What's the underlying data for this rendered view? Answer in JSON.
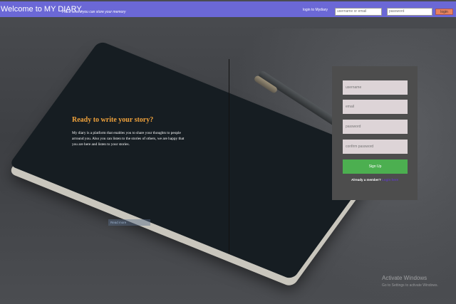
{
  "header": {
    "title": "Welcome to MY DIARY,",
    "tagline": "Place where you can store your memory",
    "login_label": "login to Mydiary",
    "username_placeholder": "username or email",
    "password_placeholder": "password",
    "login_button": "login",
    "bar_color": "#6b68d6"
  },
  "hero": {
    "heading": "Ready to write your story?",
    "description": "My diary is a platform that enables you to share your thoughts to people arround you. Also you can listen to the stories of others, we are happy that you are here and listen to your stories.",
    "heading_color": "#f0a23b"
  },
  "small_link": {
    "label": "Read more"
  },
  "signup": {
    "username_placeholder": "username",
    "email_placeholder": "email",
    "password_placeholder": "password",
    "confirm_placeholder": "confirm password",
    "button_label": "Sign Up",
    "member_text": "Already a member?",
    "login_link": "Login here",
    "button_color": "#4caf50"
  },
  "watermark": {
    "title": "Activate Windows",
    "subtitle": "Go to Settings to activate Windows."
  }
}
